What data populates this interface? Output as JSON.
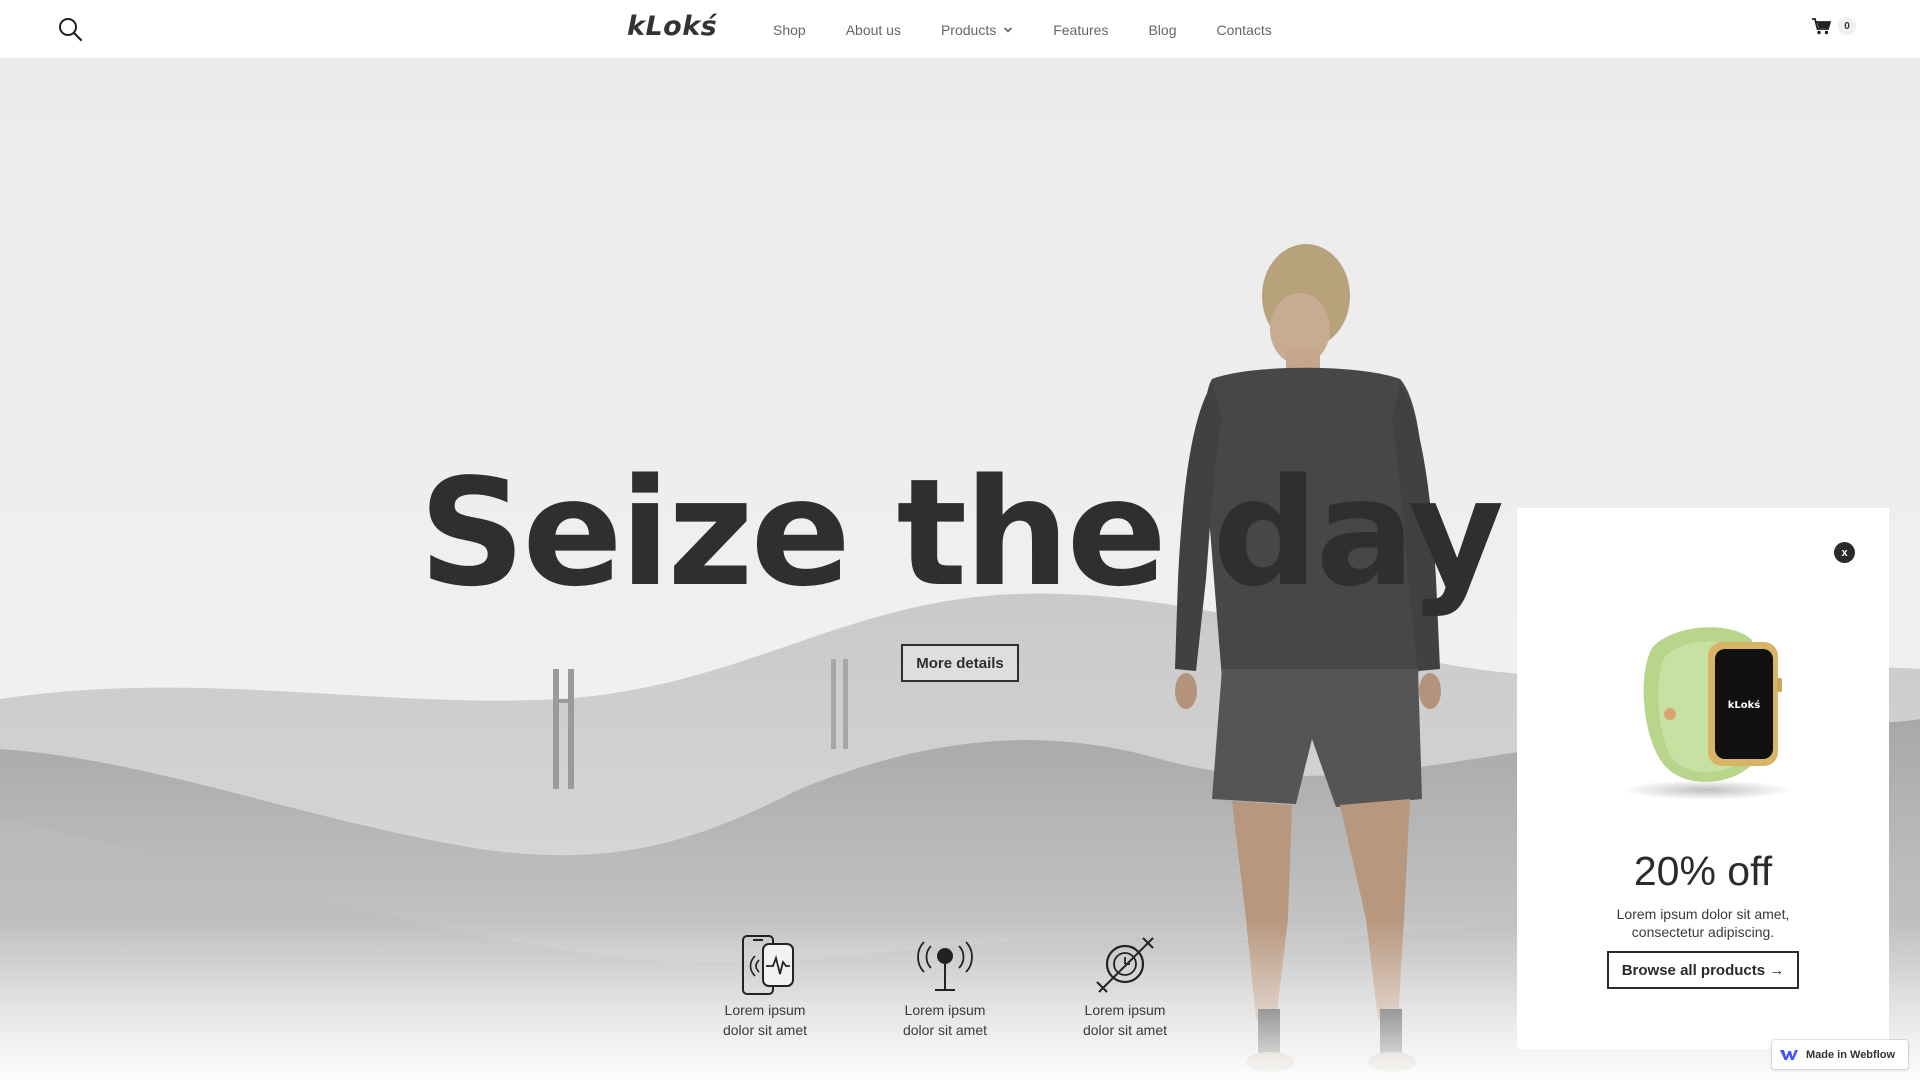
{
  "nav": {
    "logo": "kLokś",
    "menu": [
      {
        "label": "Shop"
      },
      {
        "label": "About us"
      },
      {
        "label": "Products",
        "has_dropdown": true
      },
      {
        "label": "Features"
      },
      {
        "label": "Blog"
      },
      {
        "label": "Contacts"
      }
    ],
    "cart_count": "0",
    "icons": {
      "search": "search-icon",
      "cart": "cart-icon",
      "dropdown": "chevron-down-icon"
    }
  },
  "hero": {
    "title": "Seize the day",
    "cta_label": "More details",
    "features": [
      {
        "icon": "phone-watch-heartrate-icon",
        "line1": "Lorem ipsum",
        "line2": "dolor sit amet"
      },
      {
        "icon": "signal-antenna-icon",
        "line1": "Lorem ipsum",
        "line2": "dolor sit amet"
      },
      {
        "icon": "watch-satellite-icon",
        "line1": "Lorem ipsum",
        "line2": "dolor sit amet"
      }
    ]
  },
  "popup": {
    "close_label": "x",
    "watch_brand": "kLokś",
    "headline": "20% off",
    "body": "Lorem ipsum dolor sit amet, consectetur adipiscing.",
    "button_label": "Browse all products →"
  },
  "badge": {
    "label": "Made in Webflow"
  },
  "colors": {
    "text": "#2b2b2b",
    "nav_text": "#666666",
    "popup_bg": "#ffffff",
    "watch_band": "#b8d68e",
    "watch_case": "#d9b86a"
  }
}
